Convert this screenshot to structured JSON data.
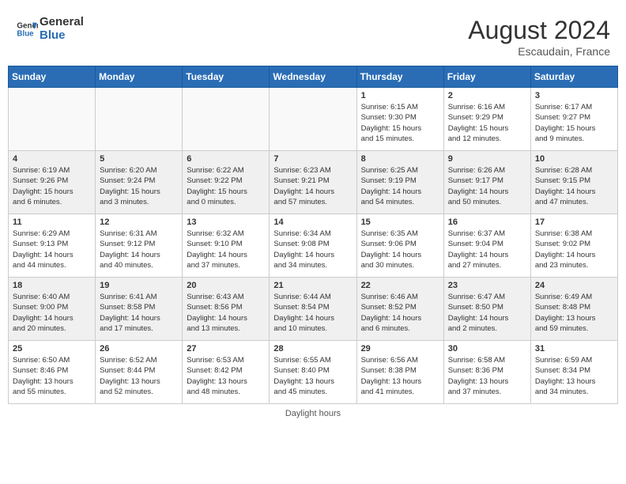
{
  "header": {
    "logo_line1": "General",
    "logo_line2": "Blue",
    "month_year": "August 2024",
    "location": "Escaudain, France"
  },
  "days_of_week": [
    "Sunday",
    "Monday",
    "Tuesday",
    "Wednesday",
    "Thursday",
    "Friday",
    "Saturday"
  ],
  "weeks": [
    [
      {
        "day": "",
        "info": "",
        "empty": true
      },
      {
        "day": "",
        "info": "",
        "empty": true
      },
      {
        "day": "",
        "info": "",
        "empty": true
      },
      {
        "day": "",
        "info": "",
        "empty": true
      },
      {
        "day": "1",
        "info": "Sunrise: 6:15 AM\nSunset: 9:30 PM\nDaylight: 15 hours\nand 15 minutes."
      },
      {
        "day": "2",
        "info": "Sunrise: 6:16 AM\nSunset: 9:29 PM\nDaylight: 15 hours\nand 12 minutes."
      },
      {
        "day": "3",
        "info": "Sunrise: 6:17 AM\nSunset: 9:27 PM\nDaylight: 15 hours\nand 9 minutes."
      }
    ],
    [
      {
        "day": "4",
        "info": "Sunrise: 6:19 AM\nSunset: 9:26 PM\nDaylight: 15 hours\nand 6 minutes."
      },
      {
        "day": "5",
        "info": "Sunrise: 6:20 AM\nSunset: 9:24 PM\nDaylight: 15 hours\nand 3 minutes."
      },
      {
        "day": "6",
        "info": "Sunrise: 6:22 AM\nSunset: 9:22 PM\nDaylight: 15 hours\nand 0 minutes."
      },
      {
        "day": "7",
        "info": "Sunrise: 6:23 AM\nSunset: 9:21 PM\nDaylight: 14 hours\nand 57 minutes."
      },
      {
        "day": "8",
        "info": "Sunrise: 6:25 AM\nSunset: 9:19 PM\nDaylight: 14 hours\nand 54 minutes."
      },
      {
        "day": "9",
        "info": "Sunrise: 6:26 AM\nSunset: 9:17 PM\nDaylight: 14 hours\nand 50 minutes."
      },
      {
        "day": "10",
        "info": "Sunrise: 6:28 AM\nSunset: 9:15 PM\nDaylight: 14 hours\nand 47 minutes."
      }
    ],
    [
      {
        "day": "11",
        "info": "Sunrise: 6:29 AM\nSunset: 9:13 PM\nDaylight: 14 hours\nand 44 minutes."
      },
      {
        "day": "12",
        "info": "Sunrise: 6:31 AM\nSunset: 9:12 PM\nDaylight: 14 hours\nand 40 minutes."
      },
      {
        "day": "13",
        "info": "Sunrise: 6:32 AM\nSunset: 9:10 PM\nDaylight: 14 hours\nand 37 minutes."
      },
      {
        "day": "14",
        "info": "Sunrise: 6:34 AM\nSunset: 9:08 PM\nDaylight: 14 hours\nand 34 minutes."
      },
      {
        "day": "15",
        "info": "Sunrise: 6:35 AM\nSunset: 9:06 PM\nDaylight: 14 hours\nand 30 minutes."
      },
      {
        "day": "16",
        "info": "Sunrise: 6:37 AM\nSunset: 9:04 PM\nDaylight: 14 hours\nand 27 minutes."
      },
      {
        "day": "17",
        "info": "Sunrise: 6:38 AM\nSunset: 9:02 PM\nDaylight: 14 hours\nand 23 minutes."
      }
    ],
    [
      {
        "day": "18",
        "info": "Sunrise: 6:40 AM\nSunset: 9:00 PM\nDaylight: 14 hours\nand 20 minutes."
      },
      {
        "day": "19",
        "info": "Sunrise: 6:41 AM\nSunset: 8:58 PM\nDaylight: 14 hours\nand 17 minutes."
      },
      {
        "day": "20",
        "info": "Sunrise: 6:43 AM\nSunset: 8:56 PM\nDaylight: 14 hours\nand 13 minutes."
      },
      {
        "day": "21",
        "info": "Sunrise: 6:44 AM\nSunset: 8:54 PM\nDaylight: 14 hours\nand 10 minutes."
      },
      {
        "day": "22",
        "info": "Sunrise: 6:46 AM\nSunset: 8:52 PM\nDaylight: 14 hours\nand 6 minutes."
      },
      {
        "day": "23",
        "info": "Sunrise: 6:47 AM\nSunset: 8:50 PM\nDaylight: 14 hours\nand 2 minutes."
      },
      {
        "day": "24",
        "info": "Sunrise: 6:49 AM\nSunset: 8:48 PM\nDaylight: 13 hours\nand 59 minutes."
      }
    ],
    [
      {
        "day": "25",
        "info": "Sunrise: 6:50 AM\nSunset: 8:46 PM\nDaylight: 13 hours\nand 55 minutes."
      },
      {
        "day": "26",
        "info": "Sunrise: 6:52 AM\nSunset: 8:44 PM\nDaylight: 13 hours\nand 52 minutes."
      },
      {
        "day": "27",
        "info": "Sunrise: 6:53 AM\nSunset: 8:42 PM\nDaylight: 13 hours\nand 48 minutes."
      },
      {
        "day": "28",
        "info": "Sunrise: 6:55 AM\nSunset: 8:40 PM\nDaylight: 13 hours\nand 45 minutes."
      },
      {
        "day": "29",
        "info": "Sunrise: 6:56 AM\nSunset: 8:38 PM\nDaylight: 13 hours\nand 41 minutes."
      },
      {
        "day": "30",
        "info": "Sunrise: 6:58 AM\nSunset: 8:36 PM\nDaylight: 13 hours\nand 37 minutes."
      },
      {
        "day": "31",
        "info": "Sunrise: 6:59 AM\nSunset: 8:34 PM\nDaylight: 13 hours\nand 34 minutes."
      }
    ]
  ],
  "footer": {
    "note": "Daylight hours"
  },
  "colors": {
    "header_bg": "#2a6db5",
    "header_text": "#ffffff",
    "shaded_row": "#f0f0f0",
    "border": "#cccccc"
  }
}
